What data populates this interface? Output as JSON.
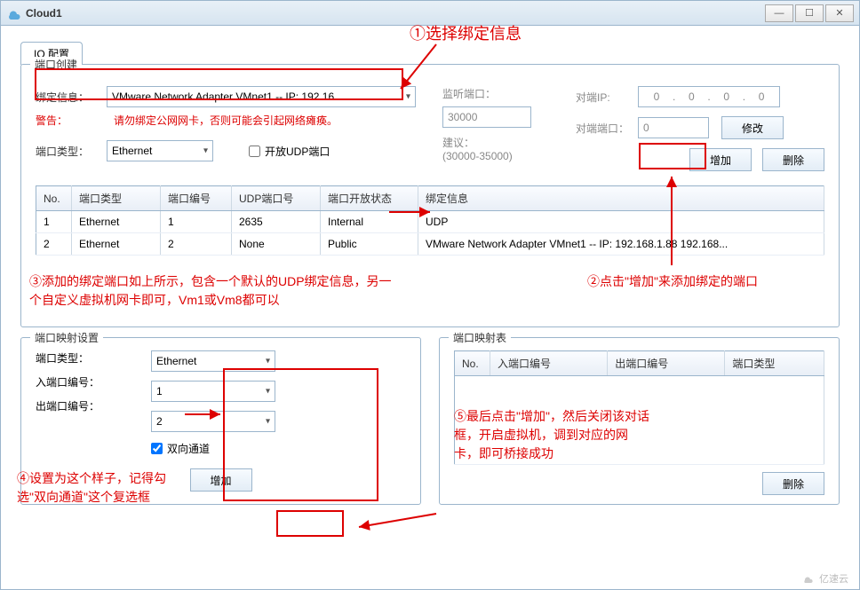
{
  "window": {
    "title": "Cloud1"
  },
  "tabs": {
    "io_config": "IO 配置"
  },
  "portCreate": {
    "legend": "端口创建",
    "bindLabel": "绑定信息：",
    "bindValue": "VMware Network Adapter VMnet1 -- IP: 192.16",
    "warnLabel": "警告：",
    "warnText": "请勿绑定公网网卡，否则可能会引起网络瘫痪。",
    "portTypeLabel": "端口类型：",
    "portTypeValue": "Ethernet",
    "openUdpLabel": "开放UDP端口",
    "listenPortLabel": "监听端口：",
    "listenPortValue": "30000",
    "suggestLabel": "建议：",
    "suggestRange": "(30000-35000)",
    "peerIpLabel": "对端IP:",
    "peerIpValue": "0 . 0 . 0 . 0",
    "peerPortLabel": "对端端口：",
    "peerPortValue": "0",
    "modifyBtn": "修改",
    "addBtn": "增加",
    "deleteBtn": "删除",
    "tableHeaders": {
      "no": "No.",
      "portType": "端口类型",
      "portNo": "端口编号",
      "udpPortNo": "UDP端口号",
      "openState": "端口开放状态",
      "bindInfo": "绑定信息"
    },
    "rows": [
      {
        "no": "1",
        "type": "Ethernet",
        "portNo": "1",
        "udp": "2635",
        "state": "Internal",
        "bind": "UDP"
      },
      {
        "no": "2",
        "type": "Ethernet",
        "portNo": "2",
        "udp": "None",
        "state": "Public",
        "bind": "VMware Network Adapter VMnet1 -- IP: 192.168.1.88 192.168..."
      }
    ]
  },
  "mapSettings": {
    "legend": "端口映射设置",
    "portTypeLabel": "端口类型：",
    "portTypeValue": "Ethernet",
    "inPortLabel": "入端口编号：",
    "inPortValue": "1",
    "outPortLabel": "出端口编号：",
    "outPortValue": "2",
    "bidirLabel": "双向通道",
    "addBtn": "增加"
  },
  "mapTable": {
    "legend": "端口映射表",
    "headers": {
      "no": "No.",
      "inPort": "入端口编号",
      "outPort": "出端口编号",
      "portType": "端口类型"
    },
    "deleteBtn": "删除"
  },
  "annotations": {
    "a1": "①选择绑定信息",
    "a2": "②点击\"增加\"来添加绑定的端口",
    "a3": "③添加的绑定端口如上所示，包含一个默认的UDP绑定信息，另一个自定义虚拟机网卡即可，Vm1或Vm8都可以",
    "a4": "④设置为这个样子，记得勾选\"双向通道\"这个复选框",
    "a5": "⑤最后点击\"增加\"，然后关闭该对话框，开启虚拟机，调到对应的网卡，即可桥接成功"
  },
  "footer": "亿速云"
}
